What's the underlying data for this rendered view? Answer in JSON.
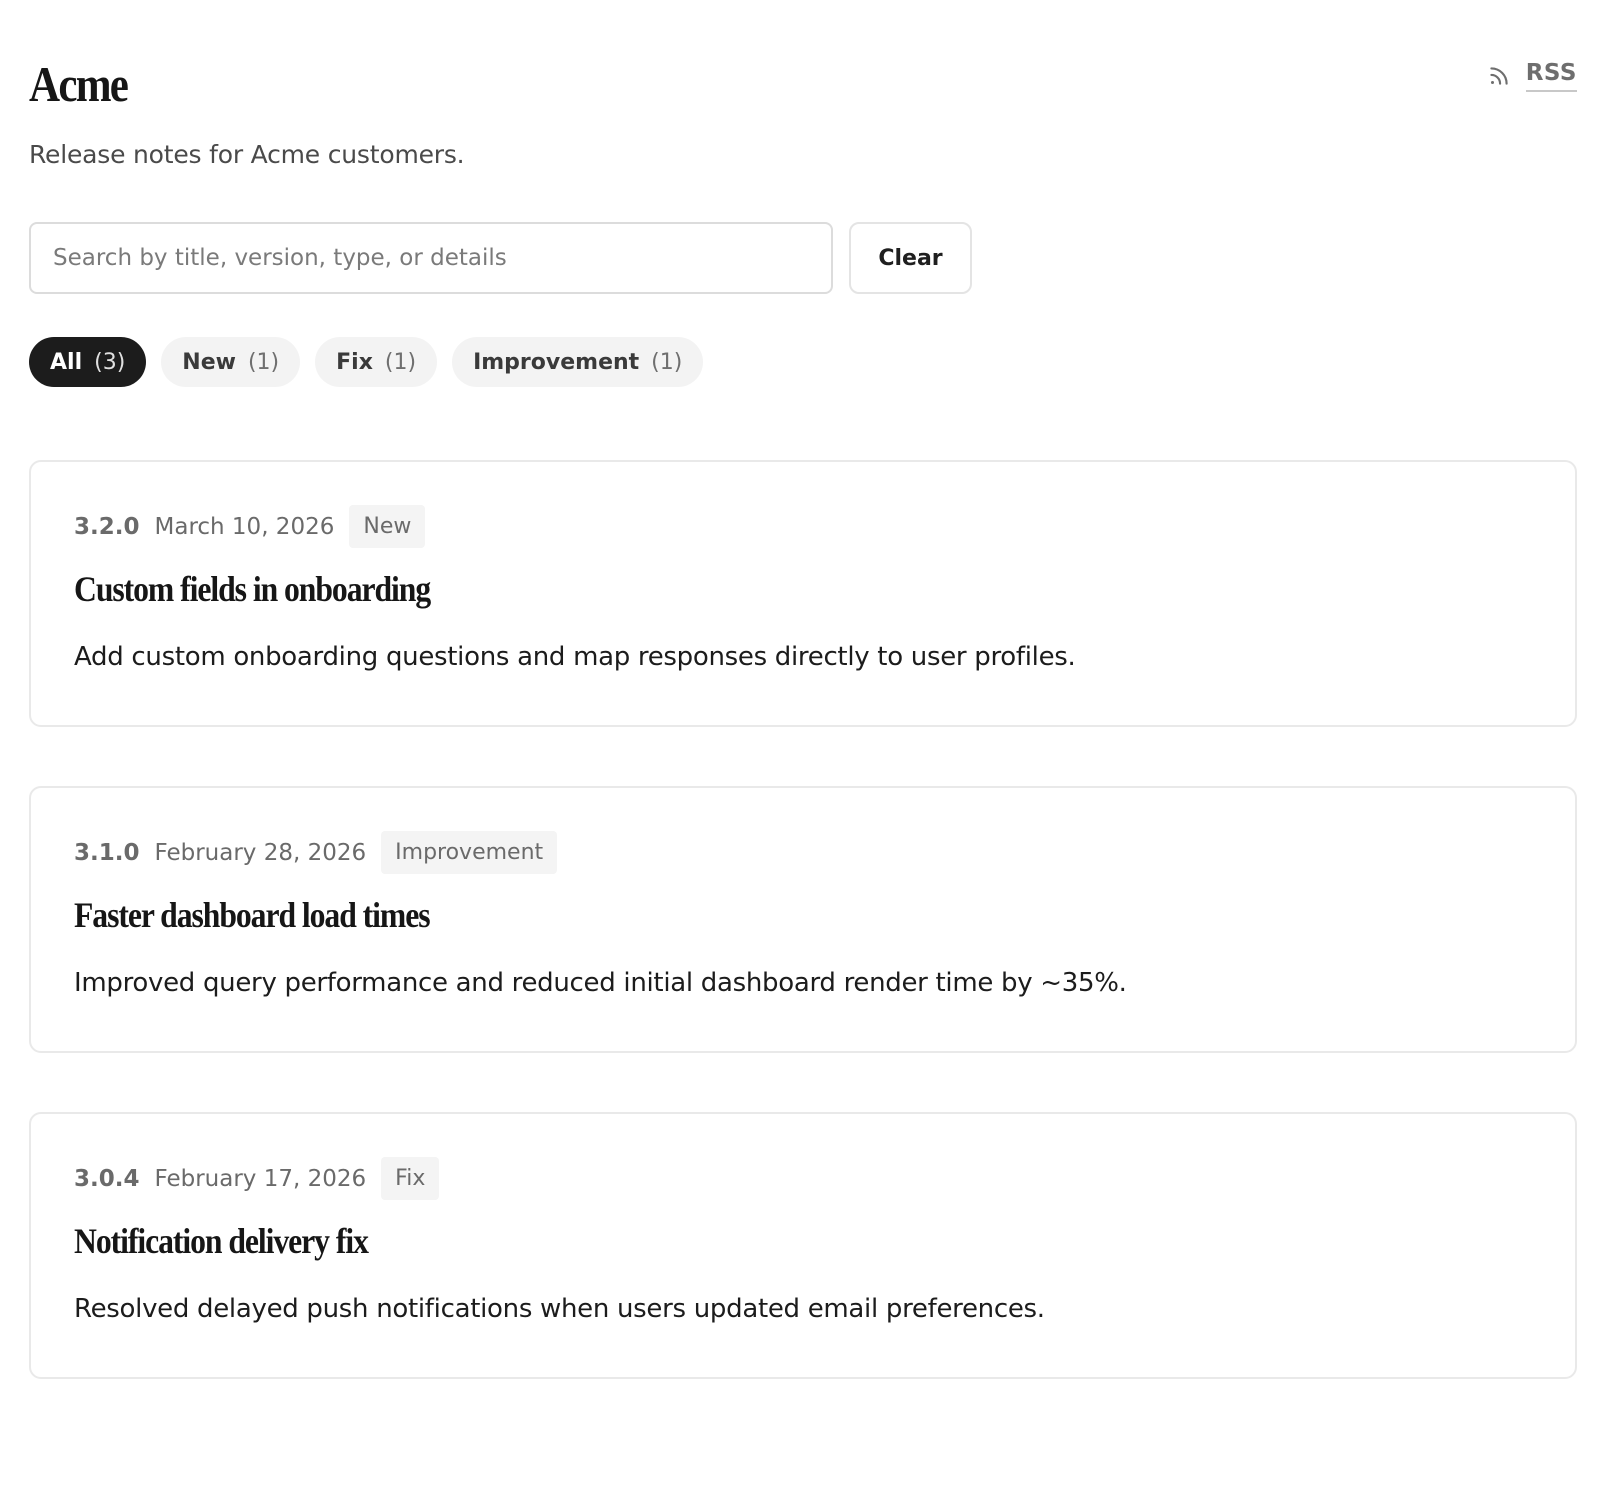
{
  "header": {
    "title": "Acme",
    "tagline": "Release notes for Acme customers.",
    "rss_label": "RSS",
    "rss_icon": "rss-icon"
  },
  "search": {
    "placeholder": "Search by title, version, type, or details",
    "value": "",
    "clear_label": "Clear"
  },
  "filters": [
    {
      "label": "All",
      "count": "(3)",
      "active": true
    },
    {
      "label": "New",
      "count": "(1)",
      "active": false
    },
    {
      "label": "Fix",
      "count": "(1)",
      "active": false
    },
    {
      "label": "Improvement",
      "count": "(1)",
      "active": false
    }
  ],
  "releases": [
    {
      "version": "3.2.0",
      "date": "March 10, 2026",
      "type": "New",
      "title": "Custom fields in onboarding",
      "description": "Add custom onboarding questions and map responses directly to user profiles."
    },
    {
      "version": "3.1.0",
      "date": "February 28, 2026",
      "type": "Improvement",
      "title": "Faster dashboard load times",
      "description": "Improved query performance and reduced initial dashboard render time by ~35%."
    },
    {
      "version": "3.0.4",
      "date": "February 17, 2026",
      "type": "Fix",
      "title": "Notification delivery fix",
      "description": "Resolved delayed push notifications when users updated email preferences."
    }
  ],
  "colors": {
    "active_chip": "#1c1c1c",
    "chip_background": "#f3f3f3",
    "badge_background": "#f4f4f4",
    "border": "#e9e9e9"
  }
}
